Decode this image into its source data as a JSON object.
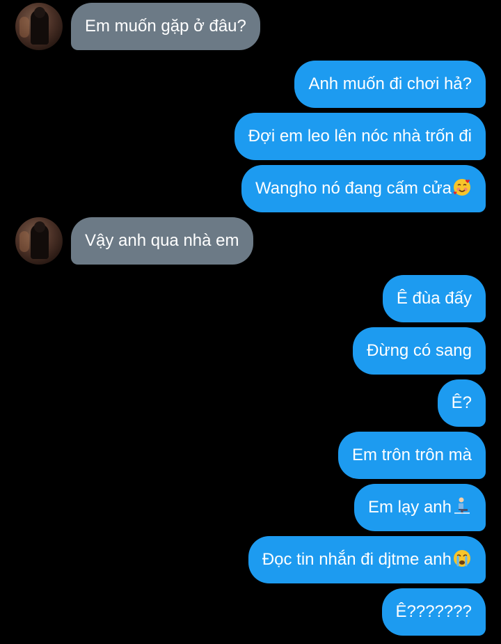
{
  "chat": {
    "messages": [
      {
        "side": "in",
        "text": "Em muốn gặp ở đâu?"
      },
      {
        "side": "out",
        "text": "Anh muốn đi chơi hả?"
      },
      {
        "side": "out",
        "text": "Đợi em leo lên nóc nhà trốn đi"
      },
      {
        "side": "out",
        "text": "Wangho nó đang cấm cửa",
        "emoji": "smiling-face-with-hearts-icon"
      },
      {
        "side": "in",
        "text": "Vậy anh qua nhà em"
      },
      {
        "side": "out",
        "text": "Ê đùa đấy"
      },
      {
        "side": "out",
        "text": "Đừng có sang"
      },
      {
        "side": "out",
        "text": "Ê?"
      },
      {
        "side": "out",
        "text": "Em trôn trôn mà"
      },
      {
        "side": "out",
        "text": "Em lạy anh",
        "emoji": "kneeling-person-icon"
      },
      {
        "side": "out",
        "text": "Đọc tin nhắn đi djtme anh",
        "emoji": "crying-face-icon"
      },
      {
        "side": "out",
        "text": "Ê???????"
      }
    ]
  },
  "colors": {
    "background": "#000000",
    "outgoing_bubble": "#1d9bf0",
    "incoming_bubble": "#6c7a86",
    "text": "#ffffff"
  }
}
